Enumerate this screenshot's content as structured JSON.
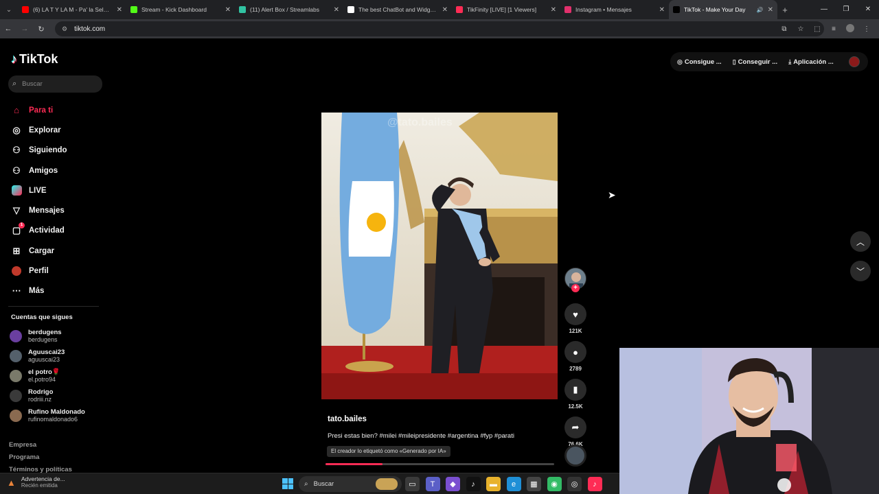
{
  "browser": {
    "tabs": [
      {
        "title": "(6) LA T Y LA M - Pa' la Selecció",
        "favicon_color": "#ff0000"
      },
      {
        "title": "Stream - Kick Dashboard",
        "favicon_color": "#53fc18"
      },
      {
        "title": "(11) Alert Box / Streamlabs",
        "favicon_color": "#31c3a2"
      },
      {
        "title": "The best ChatBot and Widgets",
        "favicon_color": "#ffffff"
      },
      {
        "title": "TikFinity [LIVE] [1 Viewers]",
        "favicon_color": "#fe2c55"
      },
      {
        "title": "Instagram • Mensajes",
        "favicon_color": "#e1306c"
      },
      {
        "title": "TikTok - Make Your Day",
        "favicon_color": "#000000"
      }
    ],
    "url": "tiktok.com"
  },
  "sidebar": {
    "logo": "TikTok",
    "search_placeholder": "Buscar",
    "nav": [
      {
        "label": "Para ti",
        "icon": "home-icon",
        "active": true
      },
      {
        "label": "Explorar",
        "icon": "compass-icon"
      },
      {
        "label": "Siguiendo",
        "icon": "following-icon"
      },
      {
        "label": "Amigos",
        "icon": "friends-icon"
      },
      {
        "label": "LIVE",
        "icon": "live-icon"
      },
      {
        "label": "Mensajes",
        "icon": "messages-icon"
      },
      {
        "label": "Actividad",
        "icon": "activity-icon",
        "badge": "1"
      },
      {
        "label": "Cargar",
        "icon": "upload-icon"
      },
      {
        "label": "Perfil",
        "icon": "profile-icon"
      },
      {
        "label": "Más",
        "icon": "more-icon"
      }
    ],
    "following_title": "Cuentas que sigues",
    "following": [
      {
        "name": "berdugens",
        "handle": "berdugens",
        "color": "#6a3fa0"
      },
      {
        "name": "Aguuscai23",
        "handle": "aguuscai23",
        "color": "#54606b"
      },
      {
        "name": "el potro🌹",
        "handle": "el.potro94",
        "color": "#7a7a6a"
      },
      {
        "name": "Rodrigo",
        "handle": "rodriii.nz",
        "color": "#3a3a3a"
      },
      {
        "name": "Rufino Maldonado",
        "handle": "rufinomaldonado6",
        "color": "#8a6a50"
      }
    ],
    "footer": [
      "Empresa",
      "Programa",
      "Términos y políticas"
    ]
  },
  "header": {
    "buttons": [
      {
        "label": "Consigue ...",
        "icon": "coin-icon"
      },
      {
        "label": "Conseguir ...",
        "icon": "phone-icon"
      },
      {
        "label": "Aplicación ...",
        "icon": "download-icon"
      }
    ]
  },
  "video": {
    "watermark": "@tato.bailes",
    "author": "tato.bailes",
    "caption": "Presi estas bien? #milei #mileipresidente #argentina #fyp #parati",
    "ai_label": "El creador lo etiquetó como «Generado por IA»",
    "progress": 0.25,
    "likes": "121K",
    "comments": "2789",
    "saves": "12.5K",
    "shares": "76.6K"
  },
  "taskbar": {
    "notification_title": "Advertencia de...",
    "notification_sub": "Recién emitida",
    "search_label": "Buscar"
  }
}
